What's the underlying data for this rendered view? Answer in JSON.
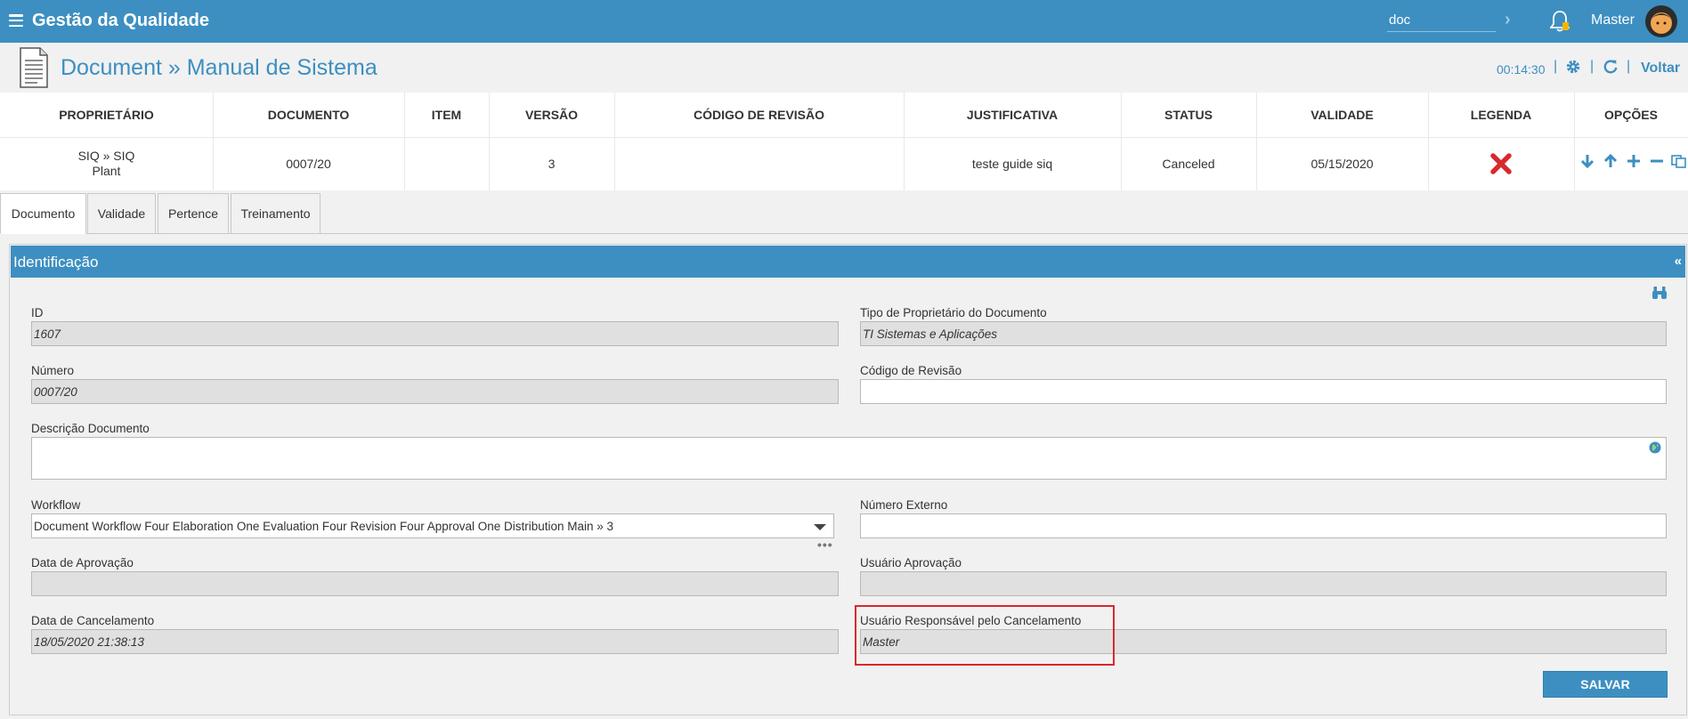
{
  "topbar": {
    "app_title": "Gestão da Qualidade",
    "search_value": "doc",
    "user_name": "Master"
  },
  "header": {
    "title": "Document » Manual de Sistema",
    "timer": "00:14:30",
    "back_label": "Voltar"
  },
  "summary": {
    "columns": [
      "PROPRIETÁRIO",
      "DOCUMENTO",
      "ITEM",
      "VERSÃO",
      "CÓDIGO DE REVISÃO",
      "JUSTIFICATIVA",
      "STATUS",
      "VALIDADE",
      "LEGENDA",
      "OPÇÕES"
    ],
    "row": {
      "owner_line1": "SIQ » SIQ",
      "owner_line2": "Plant",
      "document": "0007/20",
      "item": "",
      "version": "3",
      "revision_code": "",
      "justification": "teste guide siq",
      "status": "Canceled",
      "validity": "05/15/2020"
    },
    "legend_color": "#d8282f"
  },
  "tabs": [
    {
      "label": "Documento",
      "active": true
    },
    {
      "label": "Validade",
      "active": false
    },
    {
      "label": "Pertence",
      "active": false
    },
    {
      "label": "Treinamento",
      "active": false
    }
  ],
  "panel": {
    "title": "Identificação",
    "fields": {
      "id": {
        "label": "ID",
        "value": "1607"
      },
      "owner_type": {
        "label": "Tipo de Proprietário do Documento",
        "value": "TI Sistemas e Aplicações"
      },
      "number": {
        "label": "Número",
        "value": "0007/20"
      },
      "revision_code": {
        "label": "Código de Revisão",
        "value": ""
      },
      "description": {
        "label": "Descrição Documento",
        "value": ""
      },
      "workflow": {
        "label": "Workflow",
        "value": "Document Workflow Four Elaboration One Evaluation Four Revision Four Approval One Distribution Main » 3"
      },
      "external_number": {
        "label": "Número Externo",
        "value": ""
      },
      "approval_date": {
        "label": "Data de Aprovação",
        "value": ""
      },
      "approval_user": {
        "label": "Usuário Aprovação",
        "value": ""
      },
      "cancel_date": {
        "label": "Data de Cancelamento",
        "value": "18/05/2020 21:38:13"
      },
      "cancel_user": {
        "label": "Usuário Responsável pelo Cancelamento",
        "value": "Master"
      }
    },
    "save_label": "SALVAR"
  },
  "colors": {
    "primary": "#3d8fc1",
    "highlight": "#d8282f"
  }
}
